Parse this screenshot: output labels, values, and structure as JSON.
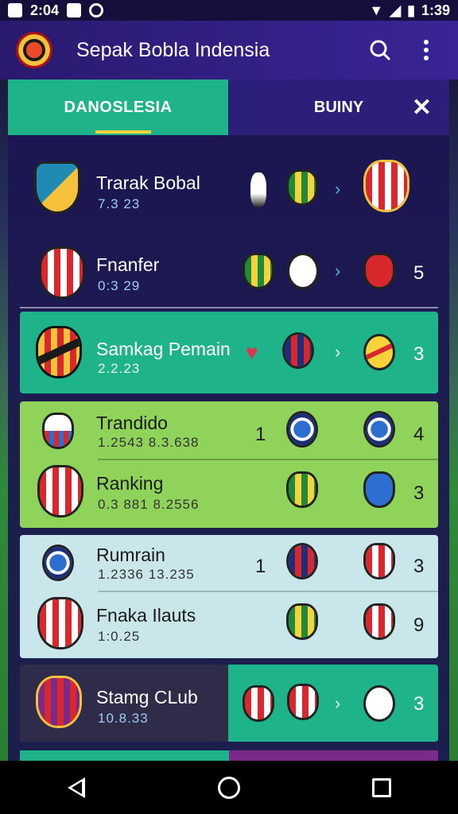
{
  "status": {
    "time": "2:04",
    "right_time": "1:39"
  },
  "app": {
    "title": "Sepak Bobla Indensia"
  },
  "tabs": [
    {
      "label": "DANOSLESIA"
    },
    {
      "label": "BUINY"
    }
  ],
  "rows": [
    {
      "name": "Trarak Bobal",
      "sub": "7.3 23",
      "score": ""
    },
    {
      "name": "Fnanfer",
      "sub": "0:3 29",
      "score": "5"
    },
    {
      "name": "Samkag Pemain",
      "sub": "2.2.23",
      "score": "3"
    },
    {
      "name": "Trandido",
      "sub": "1.2543 8.3.638",
      "left_num": "1",
      "score": "4"
    },
    {
      "name": "Ranking",
      "sub": "0.3 881 8.2556",
      "score": "3"
    },
    {
      "name": "Rumrain",
      "sub": "1.2336 13.235",
      "left_num": "1",
      "score": "3"
    },
    {
      "name": "Fnaka Ilauts",
      "sub": "1:0.25",
      "score": "9"
    },
    {
      "name": "Stamg CLub",
      "sub": "10.8.33",
      "score": "3"
    }
  ],
  "colors": {
    "accent": "#1fb38a",
    "lime": "#8fd35a",
    "light": "#c9e6ea",
    "purple": "#2a1a6e"
  }
}
